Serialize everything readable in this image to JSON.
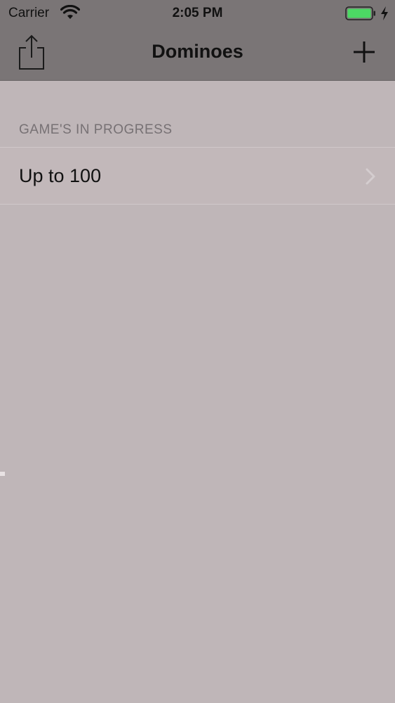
{
  "status_bar": {
    "carrier": "Carrier",
    "time": "2:05 PM",
    "wifi_icon": "wifi-icon",
    "battery_icon": "battery-icon",
    "battery_color": "#4cd964",
    "charging_icon": "bolt-icon"
  },
  "nav": {
    "title": "Dominoes",
    "left_icon": "share-icon",
    "right_icon": "plus-icon"
  },
  "section": {
    "header": "GAME'S IN PROGRESS"
  },
  "games": [
    {
      "label": "Up to 100",
      "accessory_icon": "chevron-right-icon"
    }
  ],
  "colors": {
    "bar_background": "#7a7576",
    "page_background": "#bfb6b8",
    "section_header": "#777174"
  }
}
